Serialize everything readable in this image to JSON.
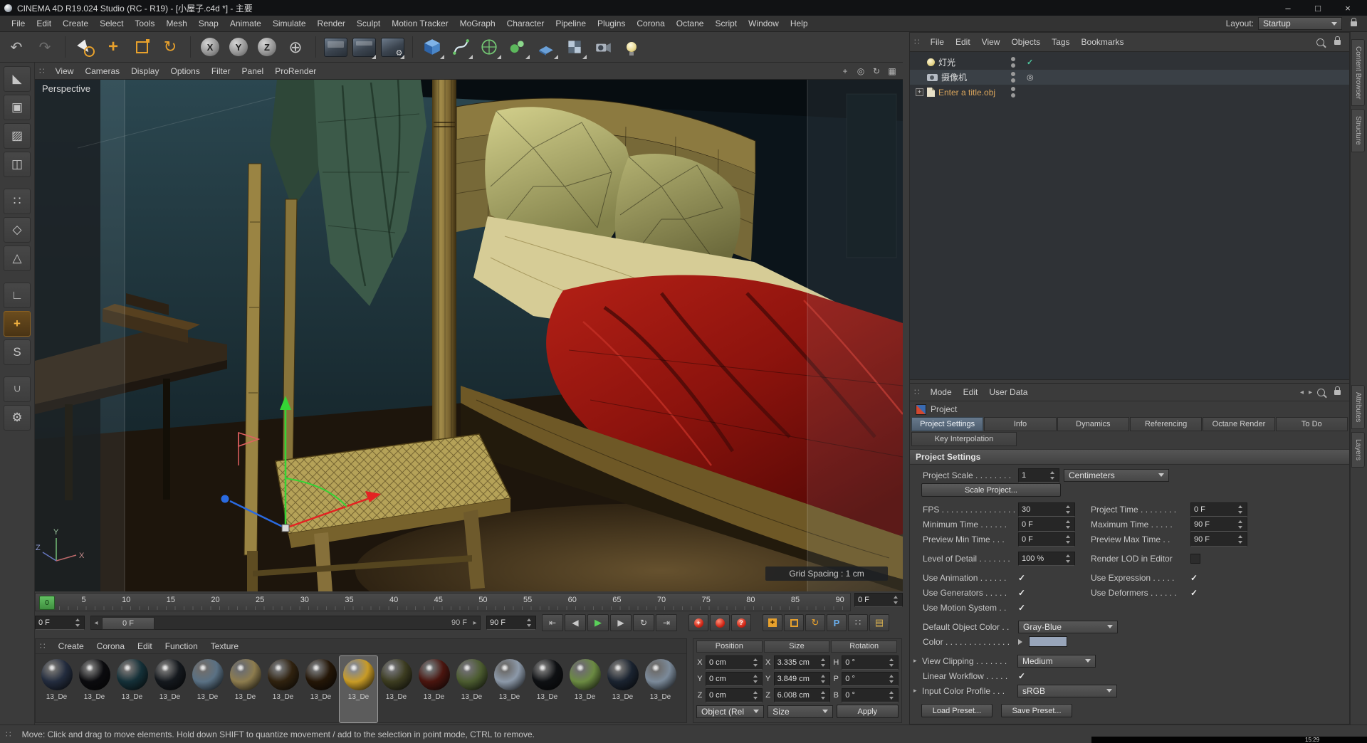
{
  "window": {
    "title": "CINEMA 4D R19.024 Studio (RC - R19) - [小屋子.c4d *] - 主要",
    "minimize": "–",
    "maximize": "□",
    "close": "×"
  },
  "menu_bar": {
    "items": [
      "File",
      "Edit",
      "Create",
      "Select",
      "Tools",
      "Mesh",
      "Snap",
      "Animate",
      "Simulate",
      "Render",
      "Sculpt",
      "Motion Tracker",
      "MoGraph",
      "Character",
      "Pipeline",
      "Plugins",
      "Corona",
      "Octane",
      "Script",
      "Window",
      "Help"
    ],
    "layout_label": "Layout:",
    "layout_value": "Startup"
  },
  "toolbar": {
    "axis_locks": [
      "X",
      "Y",
      "Z"
    ],
    "icons": [
      "undo",
      "redo",
      "live-selection",
      "move",
      "scale",
      "rotate",
      "lock-x",
      "lock-y",
      "lock-z",
      "coordinate-system",
      "render-view",
      "render-to-picture-viewer",
      "edit-render-settings",
      "add-cube",
      "add-spline",
      "add-subdivision-surface",
      "add-array",
      "add-floor",
      "add-workplane",
      "add-camera",
      "add-light"
    ]
  },
  "left_palette": {
    "icons": [
      "make-editable",
      "model-mode",
      "texture-mode",
      "workplane-mode",
      "points-mode",
      "edges-mode",
      "polygons-mode",
      "axis-mode",
      "enable-axis",
      "solo-mode",
      "snapping",
      "modeling-settings"
    ]
  },
  "viewport": {
    "menu": [
      "View",
      "Cameras",
      "Display",
      "Options",
      "Filter",
      "Panel",
      "ProRender"
    ],
    "view_label": "Perspective",
    "grid_spacing": "Grid Spacing : 1 cm",
    "axis_x": "X",
    "axis_y": "Y",
    "axis_z": "Z"
  },
  "timeline": {
    "ticks": [
      "0",
      "5",
      "10",
      "15",
      "20",
      "25",
      "30",
      "35",
      "40",
      "45",
      "50",
      "55",
      "60",
      "65",
      "70",
      "75",
      "80",
      "85",
      "90"
    ],
    "playhead": "0",
    "frame_spinner": "0 F",
    "range_thumb": "0 F",
    "range_end_label": "90 F",
    "start_field": "0 F",
    "end_field": "90 F"
  },
  "materials": {
    "tabs": [
      "Create",
      "Corona",
      "Edit",
      "Function",
      "Texture"
    ],
    "items": [
      {
        "label": "13_De",
        "color": "#232c3e"
      },
      {
        "label": "13_De",
        "color": "#0b0b0e"
      },
      {
        "label": "13_De",
        "color": "#143038"
      },
      {
        "label": "13_De",
        "color": "#14181d"
      },
      {
        "label": "13_De",
        "color": "#5a7184"
      },
      {
        "label": "13_De",
        "color": "#8d7c4e"
      },
      {
        "label": "13_De",
        "color": "#30220f"
      },
      {
        "label": "13_De",
        "color": "#241607"
      },
      {
        "label": "13_De",
        "color": "#c89b26",
        "selected": true
      },
      {
        "label": "13_De",
        "color": "#3c3c20"
      },
      {
        "label": "13_De",
        "color": "#4a150f"
      },
      {
        "label": "13_De",
        "color": "#4c5c30"
      },
      {
        "label": "13_De",
        "color": "#8c99a9"
      },
      {
        "label": "13_De",
        "color": "#0e1013"
      },
      {
        "label": "13_De",
        "color": "#6b8a42"
      },
      {
        "label": "13_De",
        "color": "#1a2330"
      },
      {
        "label": "13_De",
        "color": "#7b8a9a"
      }
    ]
  },
  "coordinates": {
    "headers": [
      "Position",
      "Size",
      "Rotation"
    ],
    "rows": [
      [
        "X",
        "0 cm",
        "X",
        "3.335 cm",
        "H",
        "0 °"
      ],
      [
        "Y",
        "0 cm",
        "Y",
        "3.849 cm",
        "P",
        "0 °"
      ],
      [
        "Z",
        "0 cm",
        "Z",
        "6.008 cm",
        "B",
        "0 °"
      ]
    ],
    "object_mode": "Object (Rel",
    "size_mode": "Size",
    "apply": "Apply"
  },
  "object_manager": {
    "menu": [
      "File",
      "Edit",
      "View",
      "Objects",
      "Tags",
      "Bookmarks"
    ],
    "items": [
      {
        "label": "灯光"
      },
      {
        "label": "摄像机"
      },
      {
        "label": "Enter a title.obj"
      }
    ]
  },
  "attribute_manager": {
    "menu": [
      "Mode",
      "Edit",
      "User Data"
    ],
    "object_label": "Project",
    "tabs": [
      {
        "label": "Project Settings",
        "active": true
      },
      {
        "label": "Info"
      },
      {
        "label": "Dynamics"
      },
      {
        "label": "Referencing"
      },
      {
        "label": "Octane Render"
      },
      {
        "label": "To Do"
      }
    ],
    "tabs_row2": [
      {
        "label": "Key Interpolation"
      }
    ],
    "section": "Project Settings",
    "labels": {
      "project_scale": "Project Scale . . . . . . . .",
      "fps": "FPS . . . . . . . . . . . . . . . .",
      "project_time": "Project Time . . . . . . . .",
      "min_time": "Minimum Time . . . . . .",
      "max_time": "Maximum Time . . . . .",
      "preview_min": "Preview Min Time . . .",
      "preview_max": "Preview Max Time . .",
      "lod": "Level of Detail . . . . . . .",
      "render_lod": "Render LOD in Editor",
      "use_animation": "Use Animation . . . . . .",
      "use_expression": "Use Expression . . . . .",
      "use_generators": "Use Generators . . . . .",
      "use_deformers": "Use Deformers . . . . . .",
      "use_motion": "Use Motion System . .",
      "default_color": "Default Object Color . .",
      "color": "Color . . . . . . . . . . . . . .",
      "view_clipping": "View Clipping . . . . . . .",
      "linear_workflow": "Linear Workflow . . . . .",
      "input_profile": "Input Color Profile . . ."
    },
    "values": {
      "project_scale": "1",
      "scale_unit": "Centimeters",
      "fps": "30",
      "project_time": "0 F",
      "min_time": "0 F",
      "max_time": "90 F",
      "preview_min": "0 F",
      "preview_max": "90 F",
      "lod": "100 %",
      "default_color": "Gray-Blue",
      "default_color_hex": "#98a5ba",
      "view_clipping": "Medium",
      "input_profile": "sRGB"
    },
    "buttons": {
      "scale_project": "Scale Project...",
      "load_preset": "Load Preset...",
      "save_preset": "Save Preset..."
    }
  },
  "side_tabs": {
    "top": [
      "Content Browser",
      "Structure"
    ],
    "bottom": [
      "Attributes",
      "Layers"
    ]
  },
  "status_bar": {
    "text": "Move: Click and drag to move elements. Hold down SHIFT to quantize movement / add to the selection in point mode, CTRL to remove."
  },
  "clock": "15:29"
}
